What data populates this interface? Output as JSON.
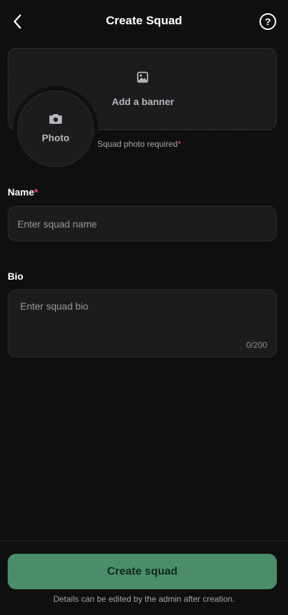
{
  "header": {
    "title": "Create Squad",
    "help_symbol": "?",
    "back_icon": "chevron-left-icon",
    "help_icon": "question-circle-icon"
  },
  "banner": {
    "label": "Add a banner",
    "icon": "image-icon"
  },
  "photo": {
    "label": "Photo",
    "icon": "camera-icon",
    "required_text": "Squad photo required",
    "required_marker": "*"
  },
  "name_field": {
    "label": "Name",
    "required_marker": "*",
    "placeholder": "Enter squad name",
    "value": ""
  },
  "bio_field": {
    "label": "Bio",
    "placeholder": "Enter squad bio",
    "value": "",
    "counter": "0/200"
  },
  "footer": {
    "create_button": "Create squad",
    "note": "Details can be edited by the admin after creation."
  },
  "colors": {
    "background": "#0f0f10",
    "surface": "#1c1c1e",
    "accent_button": "#4b8d6a",
    "required": "#ff4d5e"
  }
}
